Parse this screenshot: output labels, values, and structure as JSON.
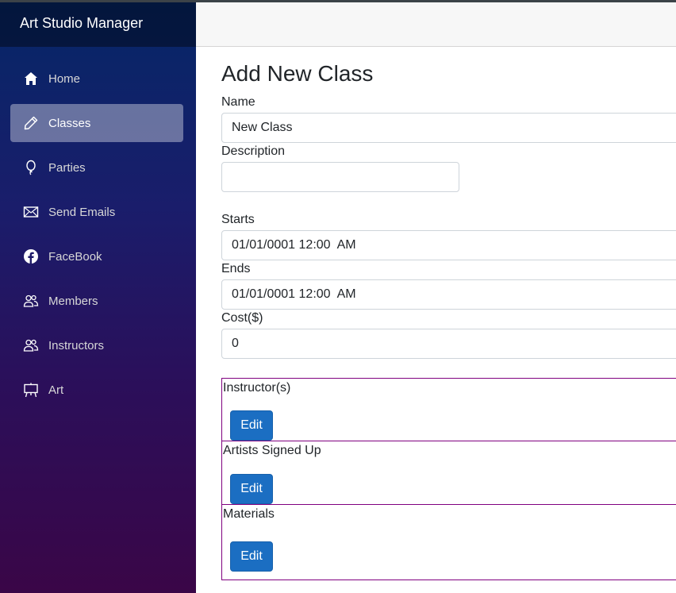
{
  "app": {
    "title": "Art Studio Manager"
  },
  "sidebar": {
    "items": [
      {
        "label": "Home",
        "icon": "home-icon",
        "active": false
      },
      {
        "label": "Classes",
        "icon": "pencil-icon",
        "active": true
      },
      {
        "label": "Parties",
        "icon": "balloon-icon",
        "active": false
      },
      {
        "label": "Send Emails",
        "icon": "envelope-icon",
        "active": false
      },
      {
        "label": "FaceBook",
        "icon": "facebook-icon",
        "active": false
      },
      {
        "label": "Members",
        "icon": "people-icon",
        "active": false
      },
      {
        "label": "Instructors",
        "icon": "people-icon",
        "active": false
      },
      {
        "label": "Art",
        "icon": "easel-icon",
        "active": false
      }
    ]
  },
  "form": {
    "title": "Add New Class",
    "name": {
      "label": "Name",
      "value": "New Class"
    },
    "description": {
      "label": "Description",
      "value": ""
    },
    "starts": {
      "label": "Starts",
      "value": "01/01/0001 12:00  AM"
    },
    "ends": {
      "label": "Ends",
      "value": "01/01/0001 12:00  AM"
    },
    "cost": {
      "label": "Cost($)",
      "value": "0"
    },
    "instructors": {
      "label": "Instructor(s)",
      "button": "Edit"
    },
    "artists": {
      "label": "Artists Signed Up",
      "button": "Edit"
    },
    "materials": {
      "label": "Materials",
      "button": "Edit"
    }
  },
  "colors": {
    "sidebar_top": "#052767",
    "sidebar_bottom": "#3a0647",
    "button": "#1b6ec2",
    "section_border": "#800080"
  }
}
